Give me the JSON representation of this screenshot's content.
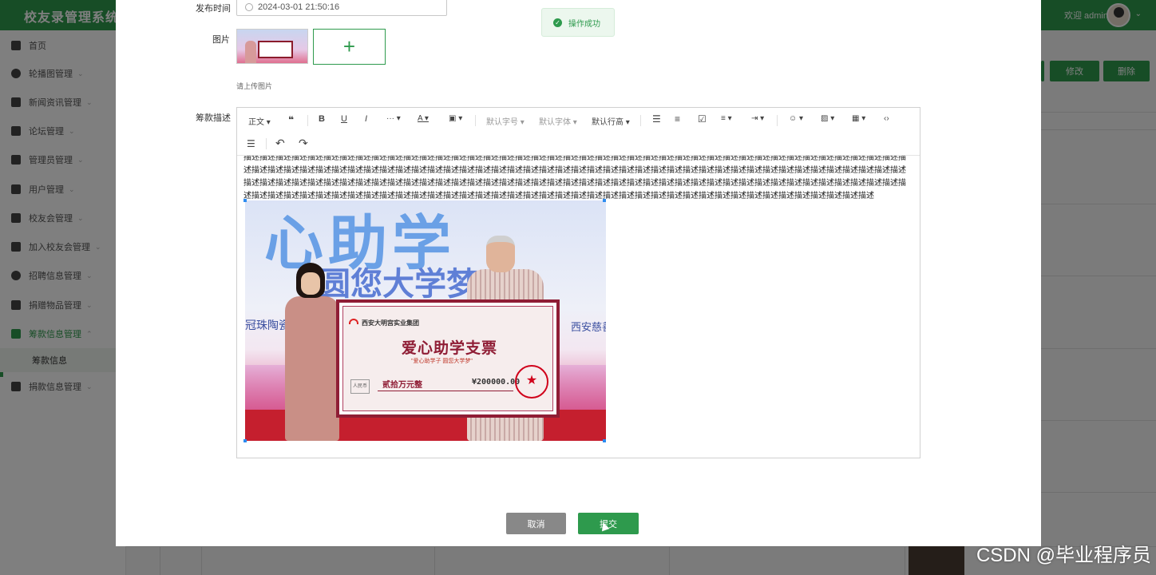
{
  "app": {
    "title": "校友录管理系统",
    "welcome": "欢迎 admin"
  },
  "sidebar": {
    "items": [
      {
        "label": "首页"
      },
      {
        "label": "轮播图管理"
      },
      {
        "label": "新闻资讯管理"
      },
      {
        "label": "论坛管理"
      },
      {
        "label": "管理员管理"
      },
      {
        "label": "用户管理"
      },
      {
        "label": "校友会管理"
      },
      {
        "label": "加入校友会管理"
      },
      {
        "label": "招聘信息管理"
      },
      {
        "label": "捐赠物品管理"
      },
      {
        "label": "筹款信息管理"
      },
      {
        "label": "捐款信息管理"
      }
    ],
    "sub_item": "筹款信息"
  },
  "background_actions": {
    "edit": "修改",
    "delete": "删除"
  },
  "dialog": {
    "publish_time_label": "发布时间",
    "publish_time_value": "2024-03-01 21:50:16",
    "image_label": "图片",
    "upload_hint": "请上传图片",
    "description_label": "筹款描述",
    "toolbar": {
      "paragraph": "正文",
      "font_size": "默认字号",
      "font_family": "默认字体",
      "line_height": "默认行高"
    },
    "description_text": "描述描述描述描述描述描述描述描述描述描述描述描述描述描述描述描述描述描述描述描述描述描述描述描述描述描述描述描述描述描述描述描述描述描述描述描述描述描述描述描述描述描述描述描述描述描述描述描述描述描述描述描述描述描述描述描述描述描述描述描述描述描述描述描述描述描述描述描述描述描述描述描述描述描述描述描述描述描述描述描述描述描述描述描述描述描述描述描述描述描述描述描述描述描述描述描述描述描述描述描述描述描述描述描述描述描述描述描述描述描述描述描述描述描述描述描述描述描述描述描述描述描述描述描述描述描述描述描述描述描述描述描述描述描述描述描述描述描述描述描述描述描述描述描述描述描述描述描述描述描述描述描述描述描述描述描述描述描述描述描述描述描述描述描述",
    "photo": {
      "banner_large": "心助学",
      "banner_slogan": "圆您大学梦",
      "side_left": "冠珠陶瓷",
      "side_right": "西安慈善",
      "company": "西安大明宫实业集团",
      "cheque_title": "爱心助学支票",
      "cheque_slogan": "\"爱心助学子 圆您大学梦\"",
      "cheque_rmb": "人民币",
      "amount_words": "贰拾万元整",
      "amount_number": "¥200000.00"
    },
    "cancel_label": "取消",
    "submit_label": "提交"
  },
  "toast": {
    "message": "操作成功"
  },
  "watermark": "CSDN @毕业程序员",
  "colors": {
    "primary": "#2e9a4d",
    "toast_bg": "#ecf7ee",
    "cancel": "#888888"
  }
}
